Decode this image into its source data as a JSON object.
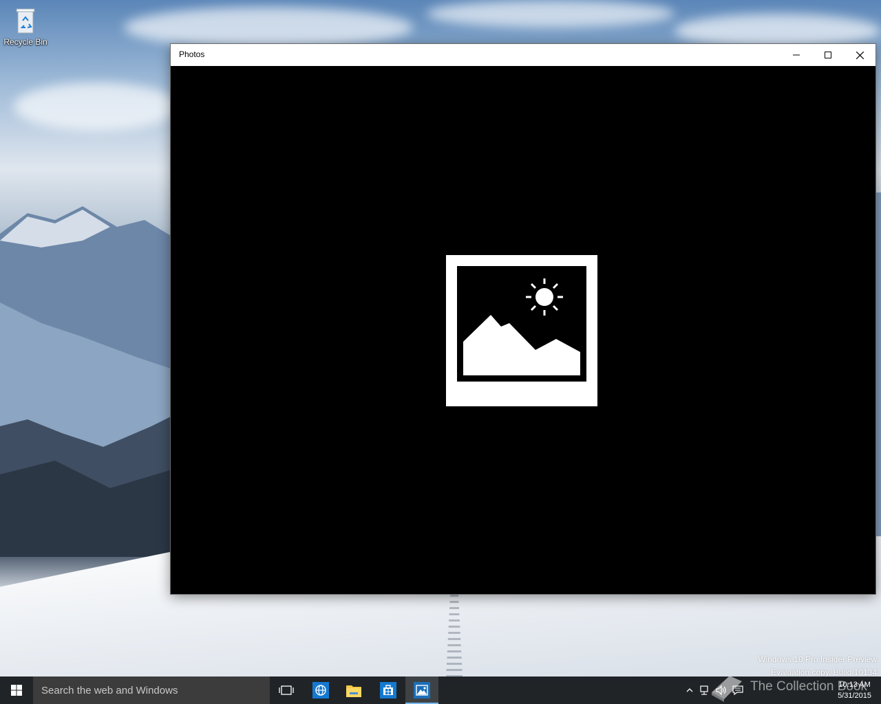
{
  "desktop": {
    "icons": [
      {
        "label": "Recycle Bin",
        "icon": "recycle-bin-icon"
      }
    ],
    "watermark_line1": "Windows 10 Pro Insider Preview",
    "watermark_line2": "Evaluation copy. Build 10134",
    "overlay_brand": "The Collection Book"
  },
  "window": {
    "title": "Photos",
    "controls": {
      "minimize": "minimize-icon",
      "maximize": "maximize-icon",
      "close": "close-icon"
    },
    "content": {
      "placeholder_icon": "photo-placeholder-icon",
      "background": "#000000"
    }
  },
  "taskbar": {
    "start_icon": "windows-logo-icon",
    "search_placeholder": "Search the web and Windows",
    "pinned": [
      {
        "name": "task-view",
        "icon": "task-view-icon",
        "active": false
      },
      {
        "name": "internet-explorer",
        "icon": "globe-icon",
        "active": false
      },
      {
        "name": "file-explorer",
        "icon": "folder-icon",
        "active": false
      },
      {
        "name": "store",
        "icon": "store-icon",
        "active": false
      },
      {
        "name": "photos",
        "icon": "photos-icon",
        "active": true
      }
    ],
    "tray": {
      "icons": [
        "chevron-up-icon",
        "network-icon",
        "volume-icon",
        "action-center-icon"
      ],
      "time": "10:13 AM",
      "date": "5/31/2015"
    },
    "accent": "#76b9ed"
  }
}
